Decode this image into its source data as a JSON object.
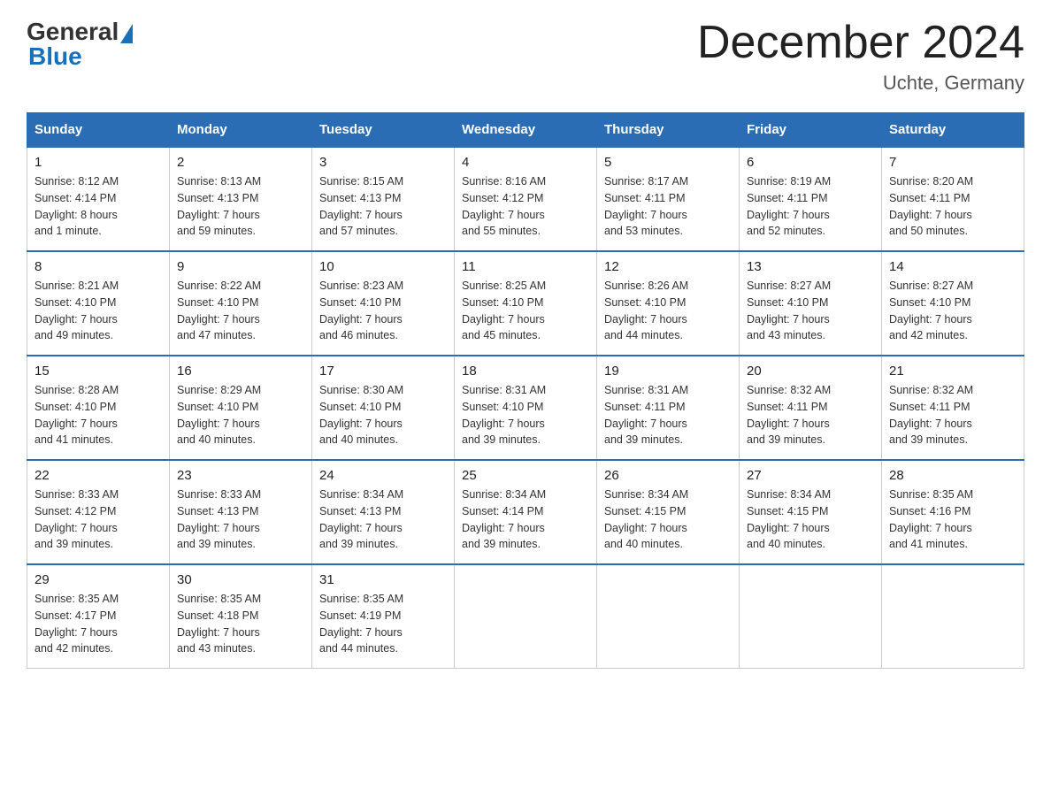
{
  "header": {
    "logo_general": "General",
    "logo_blue": "Blue",
    "month_title": "December 2024",
    "location": "Uchte, Germany"
  },
  "days_of_week": [
    "Sunday",
    "Monday",
    "Tuesday",
    "Wednesday",
    "Thursday",
    "Friday",
    "Saturday"
  ],
  "weeks": [
    [
      {
        "day": "1",
        "sunrise": "Sunrise: 8:12 AM",
        "sunset": "Sunset: 4:14 PM",
        "daylight": "Daylight: 8 hours",
        "daylight2": "and 1 minute."
      },
      {
        "day": "2",
        "sunrise": "Sunrise: 8:13 AM",
        "sunset": "Sunset: 4:13 PM",
        "daylight": "Daylight: 7 hours",
        "daylight2": "and 59 minutes."
      },
      {
        "day": "3",
        "sunrise": "Sunrise: 8:15 AM",
        "sunset": "Sunset: 4:13 PM",
        "daylight": "Daylight: 7 hours",
        "daylight2": "and 57 minutes."
      },
      {
        "day": "4",
        "sunrise": "Sunrise: 8:16 AM",
        "sunset": "Sunset: 4:12 PM",
        "daylight": "Daylight: 7 hours",
        "daylight2": "and 55 minutes."
      },
      {
        "day": "5",
        "sunrise": "Sunrise: 8:17 AM",
        "sunset": "Sunset: 4:11 PM",
        "daylight": "Daylight: 7 hours",
        "daylight2": "and 53 minutes."
      },
      {
        "day": "6",
        "sunrise": "Sunrise: 8:19 AM",
        "sunset": "Sunset: 4:11 PM",
        "daylight": "Daylight: 7 hours",
        "daylight2": "and 52 minutes."
      },
      {
        "day": "7",
        "sunrise": "Sunrise: 8:20 AM",
        "sunset": "Sunset: 4:11 PM",
        "daylight": "Daylight: 7 hours",
        "daylight2": "and 50 minutes."
      }
    ],
    [
      {
        "day": "8",
        "sunrise": "Sunrise: 8:21 AM",
        "sunset": "Sunset: 4:10 PM",
        "daylight": "Daylight: 7 hours",
        "daylight2": "and 49 minutes."
      },
      {
        "day": "9",
        "sunrise": "Sunrise: 8:22 AM",
        "sunset": "Sunset: 4:10 PM",
        "daylight": "Daylight: 7 hours",
        "daylight2": "and 47 minutes."
      },
      {
        "day": "10",
        "sunrise": "Sunrise: 8:23 AM",
        "sunset": "Sunset: 4:10 PM",
        "daylight": "Daylight: 7 hours",
        "daylight2": "and 46 minutes."
      },
      {
        "day": "11",
        "sunrise": "Sunrise: 8:25 AM",
        "sunset": "Sunset: 4:10 PM",
        "daylight": "Daylight: 7 hours",
        "daylight2": "and 45 minutes."
      },
      {
        "day": "12",
        "sunrise": "Sunrise: 8:26 AM",
        "sunset": "Sunset: 4:10 PM",
        "daylight": "Daylight: 7 hours",
        "daylight2": "and 44 minutes."
      },
      {
        "day": "13",
        "sunrise": "Sunrise: 8:27 AM",
        "sunset": "Sunset: 4:10 PM",
        "daylight": "Daylight: 7 hours",
        "daylight2": "and 43 minutes."
      },
      {
        "day": "14",
        "sunrise": "Sunrise: 8:27 AM",
        "sunset": "Sunset: 4:10 PM",
        "daylight": "Daylight: 7 hours",
        "daylight2": "and 42 minutes."
      }
    ],
    [
      {
        "day": "15",
        "sunrise": "Sunrise: 8:28 AM",
        "sunset": "Sunset: 4:10 PM",
        "daylight": "Daylight: 7 hours",
        "daylight2": "and 41 minutes."
      },
      {
        "day": "16",
        "sunrise": "Sunrise: 8:29 AM",
        "sunset": "Sunset: 4:10 PM",
        "daylight": "Daylight: 7 hours",
        "daylight2": "and 40 minutes."
      },
      {
        "day": "17",
        "sunrise": "Sunrise: 8:30 AM",
        "sunset": "Sunset: 4:10 PM",
        "daylight": "Daylight: 7 hours",
        "daylight2": "and 40 minutes."
      },
      {
        "day": "18",
        "sunrise": "Sunrise: 8:31 AM",
        "sunset": "Sunset: 4:10 PM",
        "daylight": "Daylight: 7 hours",
        "daylight2": "and 39 minutes."
      },
      {
        "day": "19",
        "sunrise": "Sunrise: 8:31 AM",
        "sunset": "Sunset: 4:11 PM",
        "daylight": "Daylight: 7 hours",
        "daylight2": "and 39 minutes."
      },
      {
        "day": "20",
        "sunrise": "Sunrise: 8:32 AM",
        "sunset": "Sunset: 4:11 PM",
        "daylight": "Daylight: 7 hours",
        "daylight2": "and 39 minutes."
      },
      {
        "day": "21",
        "sunrise": "Sunrise: 8:32 AM",
        "sunset": "Sunset: 4:11 PM",
        "daylight": "Daylight: 7 hours",
        "daylight2": "and 39 minutes."
      }
    ],
    [
      {
        "day": "22",
        "sunrise": "Sunrise: 8:33 AM",
        "sunset": "Sunset: 4:12 PM",
        "daylight": "Daylight: 7 hours",
        "daylight2": "and 39 minutes."
      },
      {
        "day": "23",
        "sunrise": "Sunrise: 8:33 AM",
        "sunset": "Sunset: 4:13 PM",
        "daylight": "Daylight: 7 hours",
        "daylight2": "and 39 minutes."
      },
      {
        "day": "24",
        "sunrise": "Sunrise: 8:34 AM",
        "sunset": "Sunset: 4:13 PM",
        "daylight": "Daylight: 7 hours",
        "daylight2": "and 39 minutes."
      },
      {
        "day": "25",
        "sunrise": "Sunrise: 8:34 AM",
        "sunset": "Sunset: 4:14 PM",
        "daylight": "Daylight: 7 hours",
        "daylight2": "and 39 minutes."
      },
      {
        "day": "26",
        "sunrise": "Sunrise: 8:34 AM",
        "sunset": "Sunset: 4:15 PM",
        "daylight": "Daylight: 7 hours",
        "daylight2": "and 40 minutes."
      },
      {
        "day": "27",
        "sunrise": "Sunrise: 8:34 AM",
        "sunset": "Sunset: 4:15 PM",
        "daylight": "Daylight: 7 hours",
        "daylight2": "and 40 minutes."
      },
      {
        "day": "28",
        "sunrise": "Sunrise: 8:35 AM",
        "sunset": "Sunset: 4:16 PM",
        "daylight": "Daylight: 7 hours",
        "daylight2": "and 41 minutes."
      }
    ],
    [
      {
        "day": "29",
        "sunrise": "Sunrise: 8:35 AM",
        "sunset": "Sunset: 4:17 PM",
        "daylight": "Daylight: 7 hours",
        "daylight2": "and 42 minutes."
      },
      {
        "day": "30",
        "sunrise": "Sunrise: 8:35 AM",
        "sunset": "Sunset: 4:18 PM",
        "daylight": "Daylight: 7 hours",
        "daylight2": "and 43 minutes."
      },
      {
        "day": "31",
        "sunrise": "Sunrise: 8:35 AM",
        "sunset": "Sunset: 4:19 PM",
        "daylight": "Daylight: 7 hours",
        "daylight2": "and 44 minutes."
      },
      null,
      null,
      null,
      null
    ]
  ]
}
